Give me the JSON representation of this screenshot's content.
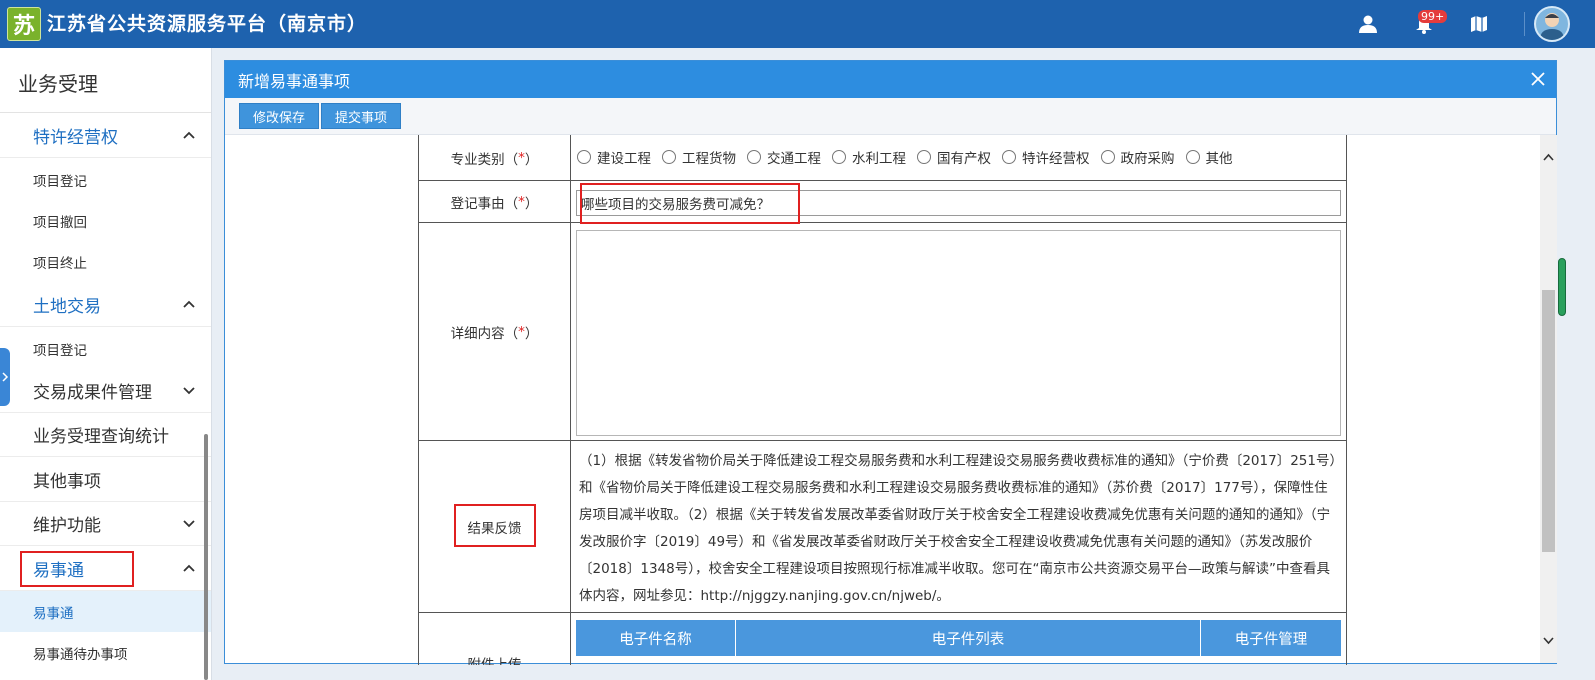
{
  "app": {
    "logo_char": "苏",
    "title": "江苏省公共资源服务平台（南京市）",
    "notification_count": "99+"
  },
  "topbar_icons": [
    "user-icon",
    "bell-icon",
    "map-icon",
    "avatar"
  ],
  "sidebar": {
    "title": "业务受理",
    "groups": [
      {
        "label": "特许经营权",
        "expanded": true,
        "items": [
          "项目登记",
          "项目撤回",
          "项目终止"
        ]
      },
      {
        "label": "土地交易",
        "expanded": true,
        "items": [
          "项目登记"
        ]
      },
      {
        "label": "交易成果件管理",
        "expanded": false
      },
      {
        "label": "业务受理查询统计"
      },
      {
        "label": "其他事项"
      },
      {
        "label": "维护功能",
        "expanded": false
      },
      {
        "label": "易事通",
        "expanded": true,
        "items": [
          "易事通",
          "易事通待办事项"
        ],
        "active_item": "易事通"
      }
    ]
  },
  "dialog": {
    "title": "新增易事通事项",
    "toolbar": {
      "save_label": "修改保存",
      "submit_label": "提交事项"
    },
    "form": {
      "category": {
        "label": "专业类别（",
        "required": "*",
        "label_end": "）",
        "options": [
          "建设工程",
          "工程货物",
          "交通工程",
          "水利工程",
          "国有产权",
          "特许经营权",
          "政府采购",
          "其他"
        ]
      },
      "reason": {
        "label": "登记事由（",
        "required": "*",
        "label_end": "）",
        "value": "哪些项目的交易服务费可减免？"
      },
      "detail": {
        "label": "详细内容（",
        "required": "*",
        "label_end": "）",
        "value": ""
      },
      "feedback": {
        "label": "结果反馈",
        "text": "（1）根据《转发省物价局关于降低建设工程交易服务费和水利工程建设交易服务费收费标准的通知》（宁价费〔2017〕251号）和《省物价局关于降低建设工程交易服务费和水利工程建设交易服务费收费标准的通知》（苏价费〔2017〕177号），保障性住房项目减半收取。（2）根据《关于转发省发展改革委省财政厅关于校舍安全工程建设收费减免优惠有关问题的通知的通知》（宁发改服价字〔2019〕49号）和《省发展改革委省财政厅关于校舍安全工程建设收费减免优惠有关问题的通知》（苏发改服价〔2018〕1348号），校舍安全工程建设项目按照现行标准减半收取。您可在“南京市公共资源交易平台—政策与解读”中查看具体内容，网址参见：http://njggzy.nanjing.gov.cn/njweb/。"
      },
      "attachment": {
        "label": "附件上传",
        "columns": [
          "电子件名称",
          "电子件列表",
          "电子件管理"
        ]
      }
    }
  },
  "colors": {
    "topbar": "#1e62ae",
    "accent": "#2d8de0",
    "required": "#e02020",
    "highlight_box": "#e02020"
  }
}
